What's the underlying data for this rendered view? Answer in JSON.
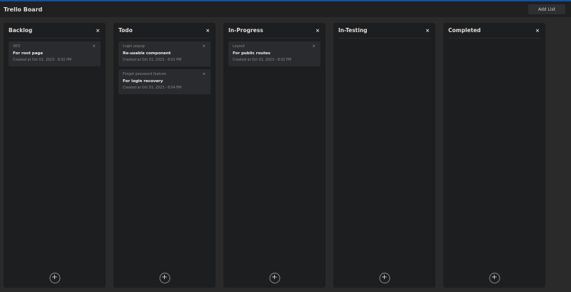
{
  "header": {
    "title": "Trello Board",
    "add_list": "Add List"
  },
  "lists": [
    {
      "title": "Backlog",
      "cards": [
        {
          "tag": "SEO",
          "name": "For root page",
          "date": "Created at Oct 01, 2023 - 8:02 PM"
        }
      ]
    },
    {
      "title": "Todo",
      "cards": [
        {
          "tag": "Login popup",
          "name": "Re-usable component",
          "date": "Created at Oct 01, 2023 - 8:01 PM"
        },
        {
          "tag": "Forgot password feature",
          "name": "For login recovery",
          "date": "Created at Oct 01, 2023 - 8:04 PM"
        }
      ]
    },
    {
      "title": "In-Progress",
      "cards": [
        {
          "tag": "Layout",
          "name": "For public routes",
          "date": "Created at Oct 01, 2023 - 8:02 PM"
        }
      ]
    },
    {
      "title": "In-Testing",
      "cards": []
    },
    {
      "title": "Completed",
      "cards": []
    }
  ],
  "icons": {
    "close": "×",
    "add": "+"
  }
}
